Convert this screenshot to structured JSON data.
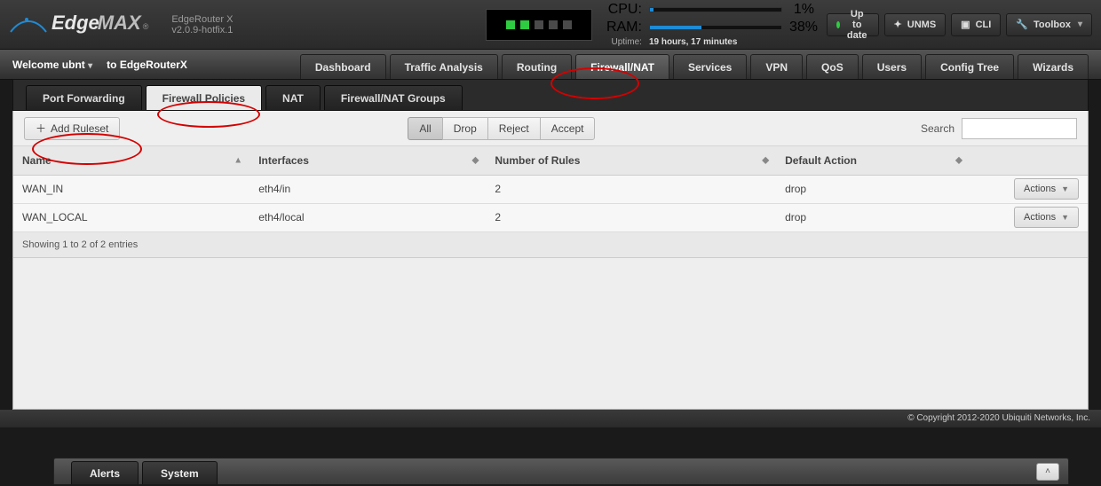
{
  "header": {
    "brand_prefix": "Edge",
    "brand_suffix": "MAX",
    "model_version": "EdgeRouter X v2.0.9-hotfix.1",
    "ports": [
      true,
      true,
      false,
      false,
      false
    ],
    "cpu_label": "CPU:",
    "cpu_value": "1%",
    "ram_label": "RAM:",
    "ram_value": "38%",
    "uptime_label": "Uptime:",
    "uptime_value": "19 hours, 17 minutes",
    "status_label": "Up to date",
    "unms_label": "UNMS",
    "cli_label": "CLI",
    "toolbox_label": "Toolbox"
  },
  "welcome": {
    "text": "Welcome ubnt",
    "to_label": "to",
    "host": "EdgeRouterX"
  },
  "main_tabs": {
    "items": [
      "Dashboard",
      "Traffic Analysis",
      "Routing",
      "Firewall/NAT",
      "Services",
      "VPN",
      "QoS",
      "Users",
      "Config Tree",
      "Wizards"
    ],
    "active": 3
  },
  "sub_tabs": {
    "items": [
      "Port Forwarding",
      "Firewall Policies",
      "NAT",
      "Firewall/NAT Groups"
    ],
    "active": 1
  },
  "toolbar": {
    "add_ruleset_label": "Add Ruleset",
    "filter_all": "All",
    "filter_drop": "Drop",
    "filter_reject": "Reject",
    "filter_accept": "Accept",
    "filter_active": 0,
    "search_label": "Search"
  },
  "table": {
    "columns": [
      "Name",
      "Interfaces",
      "Number of Rules",
      "Default Action",
      ""
    ],
    "rows": [
      {
        "name": "WAN_IN",
        "interfaces": "eth4/in",
        "rules": "2",
        "default": "drop",
        "actions_label": "Actions"
      },
      {
        "name": "WAN_LOCAL",
        "interfaces": "eth4/local",
        "rules": "2",
        "default": "drop",
        "actions_label": "Actions"
      }
    ],
    "footer_showing": "Showing 1 to 2 of 2 entries"
  },
  "copyright": "© Copyright 2012-2020 Ubiquiti Networks, Inc.",
  "bottom_tray": {
    "alerts_label": "Alerts",
    "system_label": "System"
  }
}
